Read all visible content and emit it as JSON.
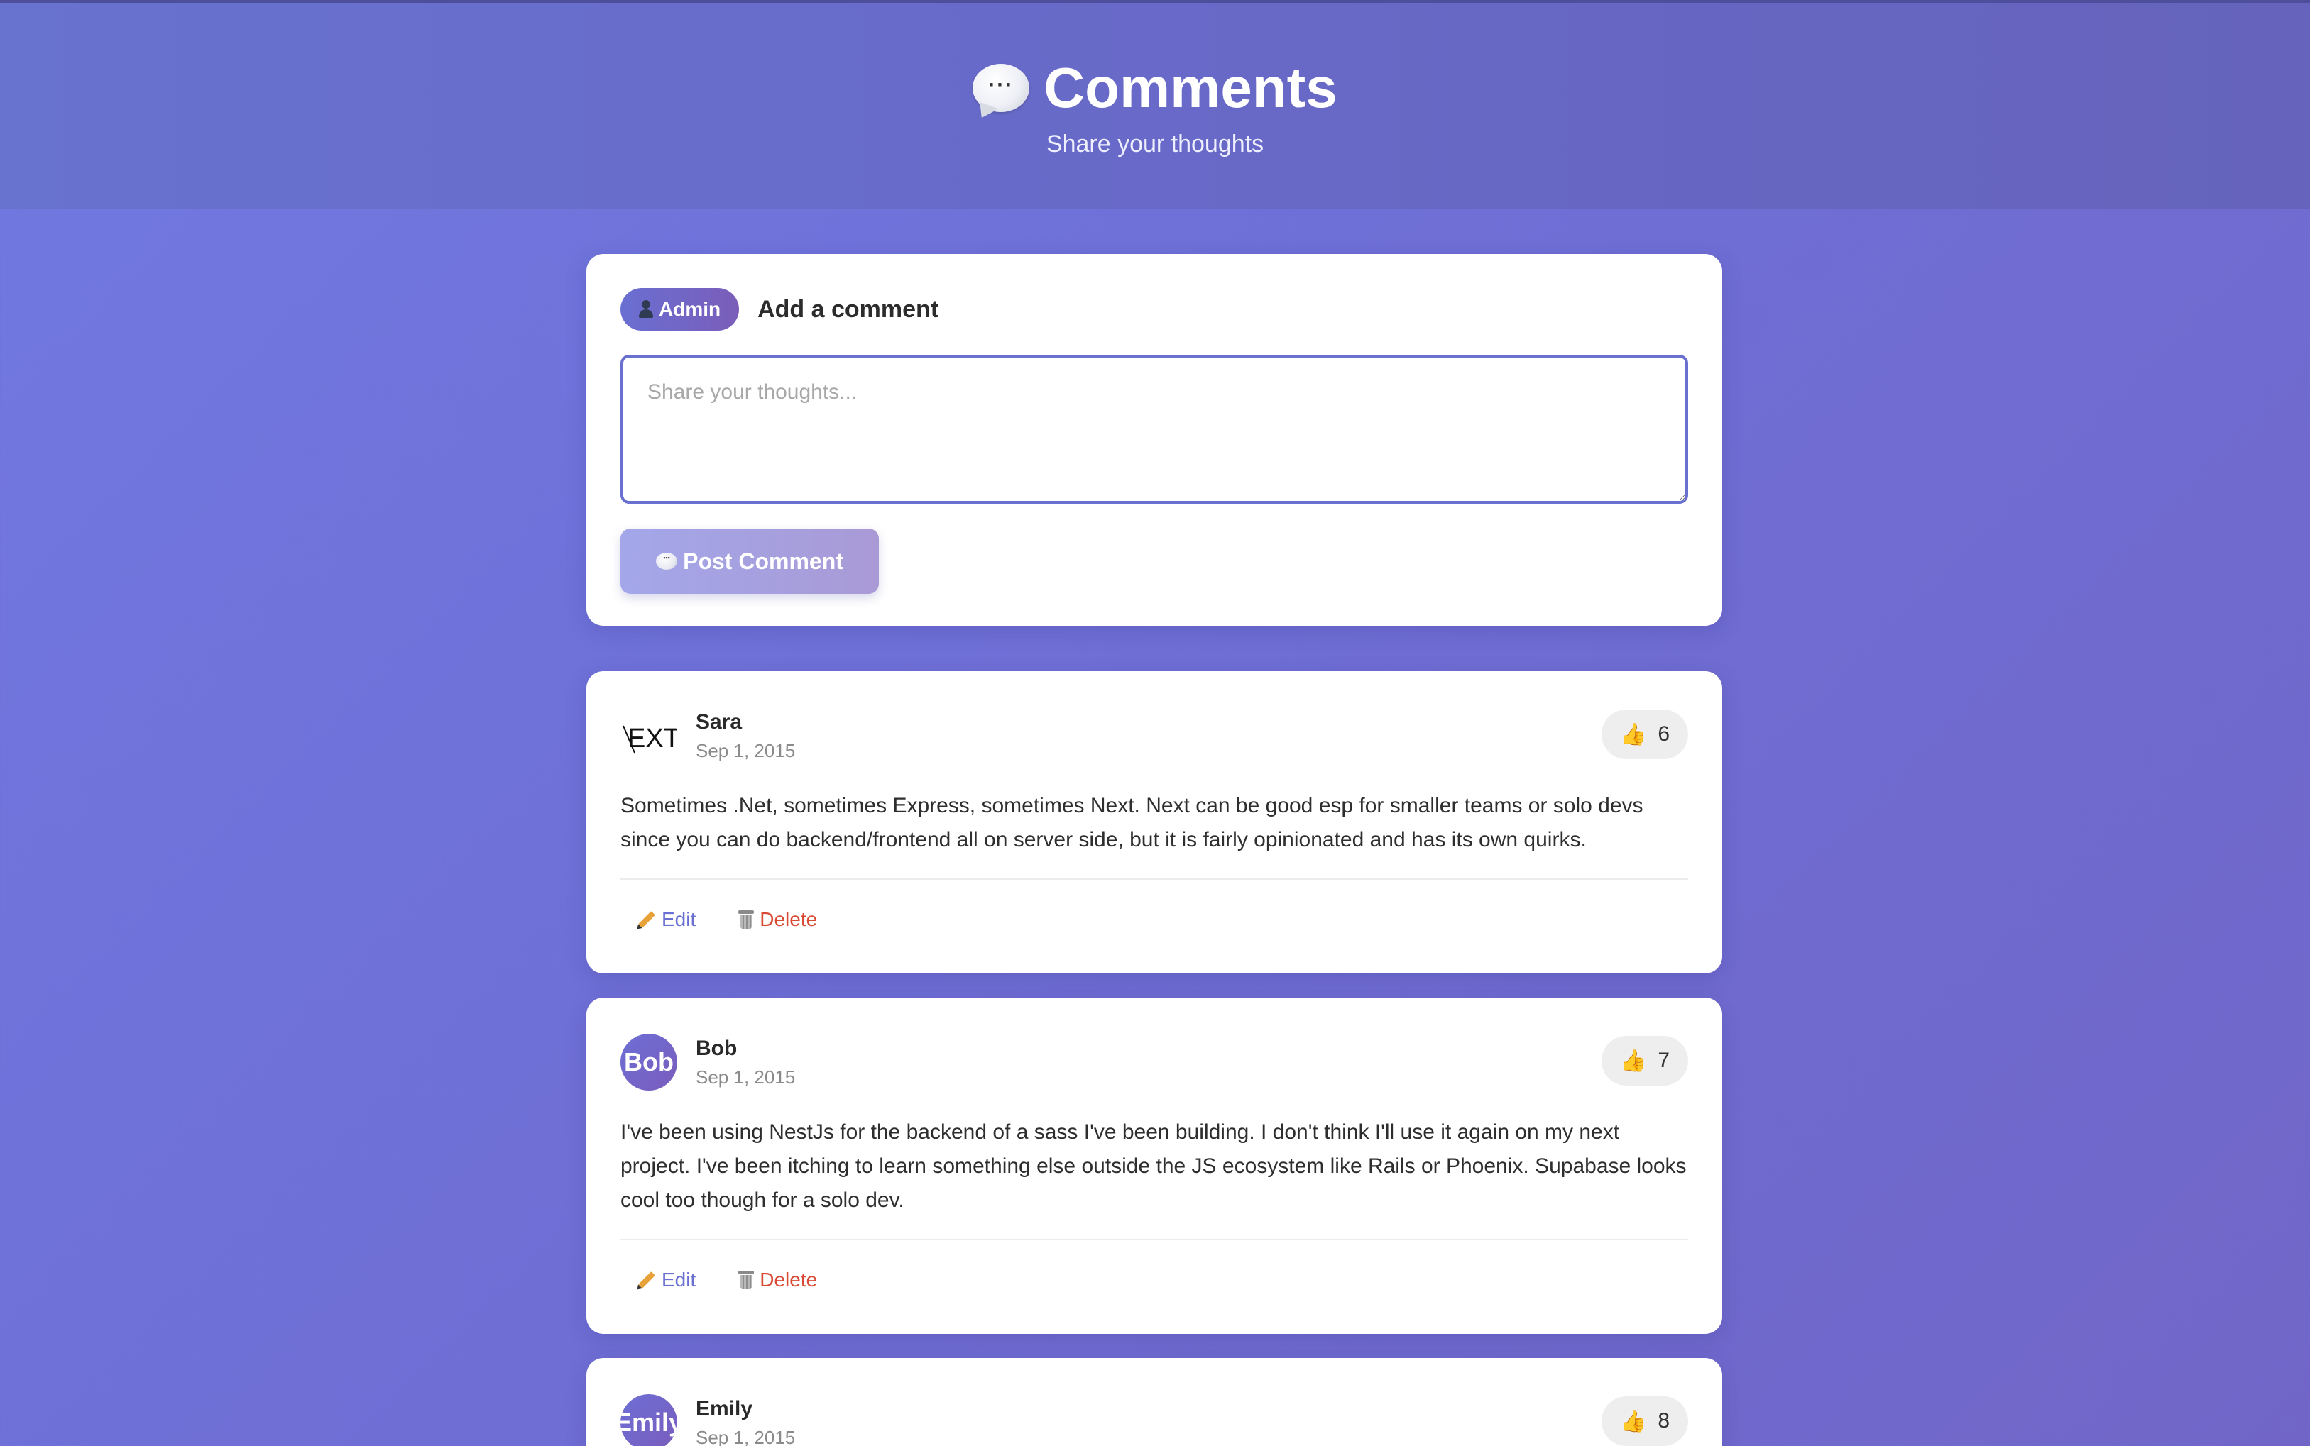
{
  "header": {
    "title": "Comments",
    "subtitle": "Share your thoughts",
    "icon": "chat-bubble-icon"
  },
  "composer": {
    "badge": "Admin",
    "title": "Add a comment",
    "placeholder": "Share your thoughts...",
    "value": "",
    "button_label": "Post Comment"
  },
  "comments": [
    {
      "author": "Sara",
      "date": "Sep 1, 2015",
      "avatar_text": "EXT",
      "likes": "6",
      "body": "Sometimes .Net, sometimes Express, sometimes Next. Next can be good esp for smaller teams or solo devs since you can do backend/frontend all on server side, but it is fairly opinionated and has its own quirks.",
      "edit_label": "Edit",
      "delete_label": "Delete"
    },
    {
      "author": "Bob",
      "date": "Sep 1, 2015",
      "avatar_text": "Bob",
      "likes": "7",
      "body": "I've been using NestJs for the backend of a sass I've been building. I don't think I'll use it again on my next project. I've been itching to learn something else outside the JS ecosystem like Rails or Phoenix. Supabase looks cool too though for a solo dev.",
      "edit_label": "Edit",
      "delete_label": "Delete"
    },
    {
      "author": "Emily",
      "date": "Sep 1, 2015",
      "avatar_text": "Emily",
      "likes": "8"
    }
  ],
  "colors": {
    "accent": "#6a6fd2",
    "delete": "#d94a35",
    "background": "#6f73d8"
  }
}
